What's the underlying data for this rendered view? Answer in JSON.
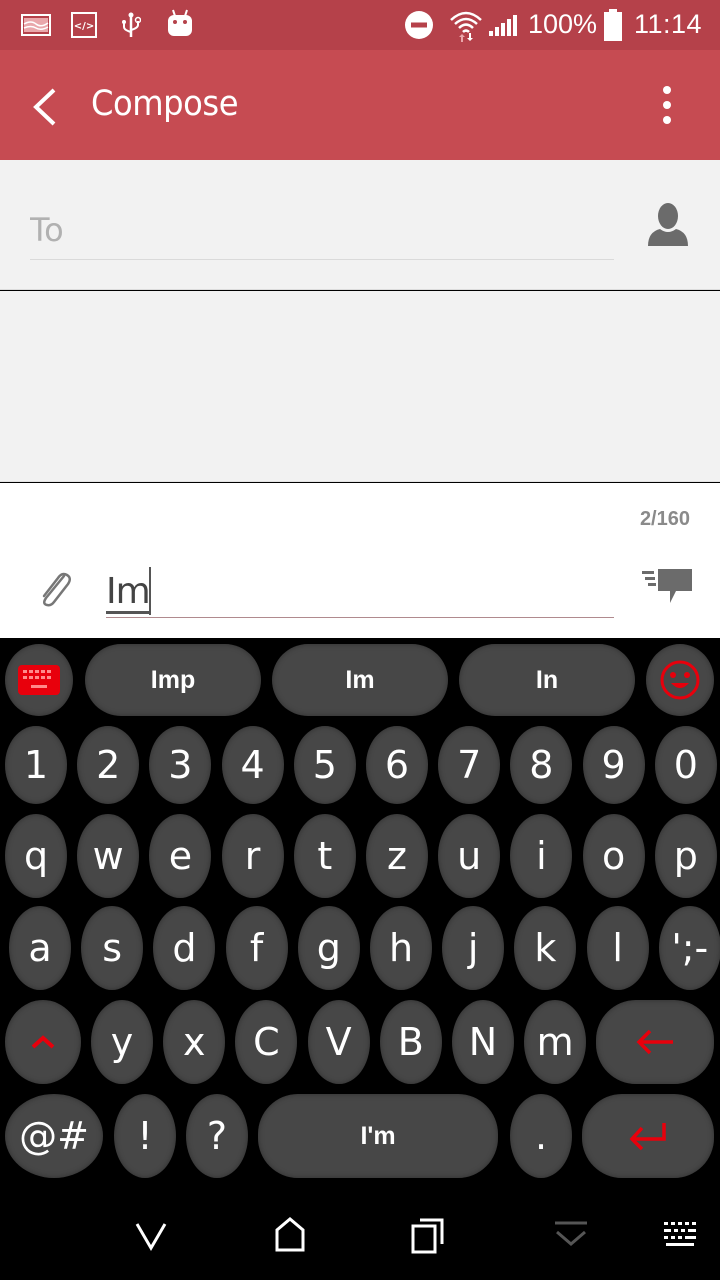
{
  "status_bar": {
    "left_icons": [
      "image-notification-icon",
      "code-icon",
      "usb-icon",
      "android-debug-icon"
    ],
    "right_icons": [
      "do-not-disturb-icon",
      "wifi-icon",
      "signal-icon",
      "battery-icon"
    ],
    "battery": "100%",
    "time": "11:14"
  },
  "app_bar": {
    "title": "Compose",
    "back_icon": "back-arrow-icon",
    "menu_icon": "overflow-menu-icon"
  },
  "to_field": {
    "placeholder": "To",
    "value": "",
    "contact_icon": "contact-person-icon"
  },
  "message": {
    "counter": "2/160",
    "value": "Im",
    "attach_icon": "paperclip-icon",
    "send_icon": "send-message-icon"
  },
  "keyboard": {
    "accent_color": "#e8000c",
    "key_color": "#474747",
    "suggestions": [
      "Imp",
      "Im",
      "In"
    ],
    "number_row": [
      "1",
      "2",
      "3",
      "4",
      "5",
      "6",
      "7",
      "8",
      "9",
      "0"
    ],
    "row1": [
      "q",
      "w",
      "e",
      "r",
      "t",
      "z",
      "u",
      "i",
      "o",
      "p"
    ],
    "row2": [
      "a",
      "s",
      "d",
      "f",
      "g",
      "h",
      "j",
      "k",
      "l",
      "';-"
    ],
    "row3": [
      "y",
      "x",
      "C",
      "V",
      "B",
      "N",
      "m"
    ],
    "row4": {
      "symbols": "@#",
      "exclaim": "!",
      "question": "?",
      "space": "I'm",
      "period": "."
    }
  },
  "nav_bar": {
    "items": [
      "back-icon",
      "home-icon",
      "recents-icon",
      "hide-keyboard-icon",
      "keyboard-switch-icon"
    ]
  }
}
